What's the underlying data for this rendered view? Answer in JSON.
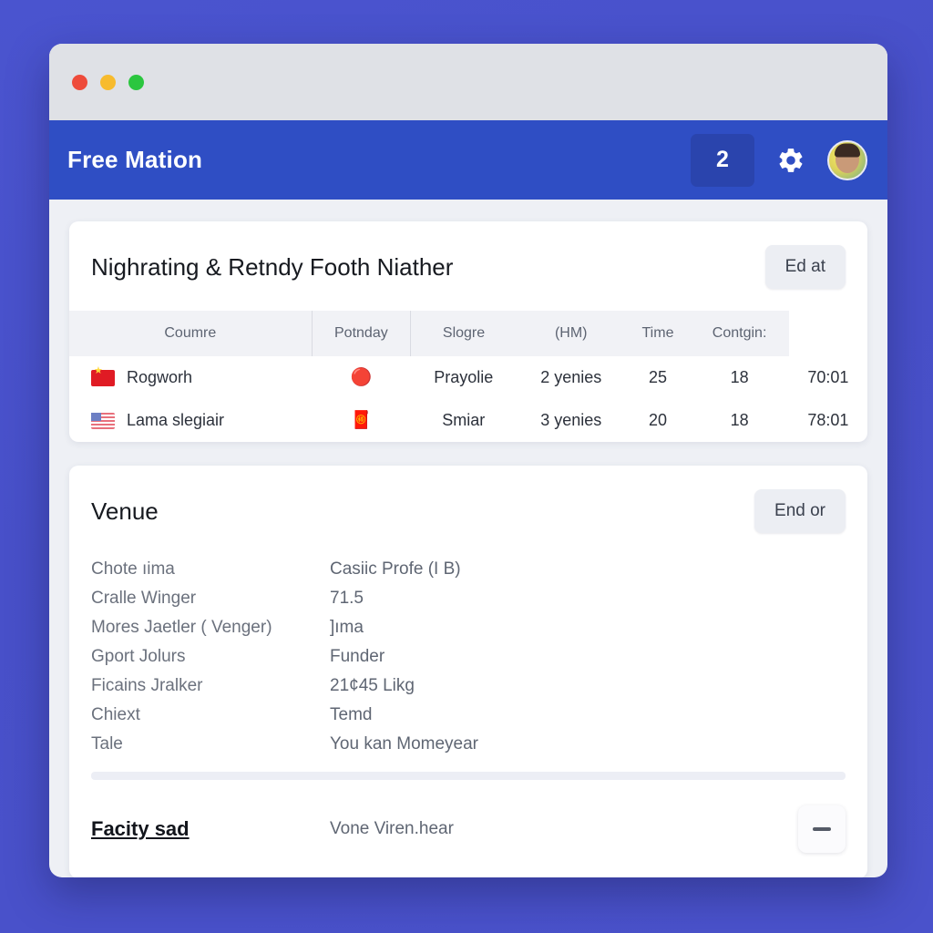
{
  "window": {
    "traffic_lights": [
      "close",
      "minimize",
      "maximize"
    ]
  },
  "appbar": {
    "title": "Free Mation",
    "badge_count": "2",
    "gear_icon": "gear-icon",
    "avatar_icon": "avatar"
  },
  "match_card": {
    "title": "Nighrating & Retndy Footh Niather",
    "action_label": "Ed at",
    "columns": [
      "Coumre",
      "Potnday",
      "Slogre",
      "(HM)",
      "Time",
      "Contgin:"
    ],
    "rows": [
      {
        "flag": "flag-cn",
        "country": "Rogworh",
        "icon": "🔴",
        "potnday": "Prayolie",
        "slogre": "2 yenies",
        "hm": "25",
        "time": "18",
        "contgin": "70:01"
      },
      {
        "flag": "flag-us",
        "country": "Lama slegiair",
        "icon": "🧧",
        "potnday": "Smiar",
        "slogre": "3 yenies",
        "hm": "20",
        "time": "18",
        "contgin": "78:01"
      }
    ]
  },
  "venue_card": {
    "title": "Venue",
    "action_label": "End or",
    "details": [
      {
        "label": "Chote ıima",
        "value": "Casiic Profe (I B)"
      },
      {
        "label": "Cralle Winger",
        "value": "71.5"
      },
      {
        "label": "Mores Jaetler  ( Venger)",
        "value": "]ıma"
      },
      {
        "label": "Gport Jolurs",
        "value": "Funder"
      },
      {
        "label": "Ficains Jralker",
        "value": "21¢45 Likg"
      },
      {
        "label": "Chiext",
        "value": "Temd"
      },
      {
        "label": "Tale",
        "value": "You kan Momeyear"
      }
    ],
    "footer": {
      "link_label": "Facity sad",
      "value": "Vone Viren.hear",
      "collapse_icon": "minus-icon"
    }
  },
  "colors": {
    "page_background": "#4a52cb",
    "appbar": "#2f4ec4",
    "badge": "#2a44ad",
    "card": "#ffffff",
    "table_header": "#f1f2f6",
    "ghost_button": "#eceef3"
  }
}
